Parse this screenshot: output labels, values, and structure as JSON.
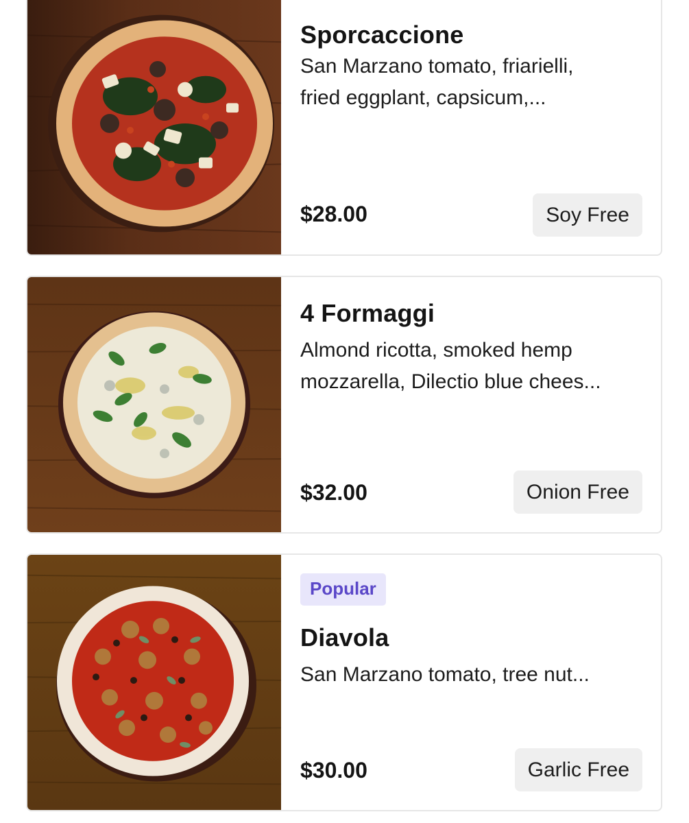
{
  "items": [
    {
      "name": "Sporcaccione",
      "description": "San Marzano tomato, friarielli,\nfried eggplant, capsicum,...",
      "price": "$28.00",
      "dietary_tag": "Soy Free",
      "badge": ""
    },
    {
      "name": "4 Formaggi",
      "description": "Almond ricotta, smoked hemp\nmozzarella, Dilectio blue chees...",
      "price": "$32.00",
      "dietary_tag": "Onion Free",
      "badge": ""
    },
    {
      "name": "Diavola",
      "description": "San Marzano tomato, tree nut...",
      "price": "$30.00",
      "dietary_tag": "Garlic Free",
      "badge": "Popular"
    }
  ],
  "colors": {
    "badge_bg": "#e8e6fb",
    "badge_text": "#5a47c8",
    "tag_bg": "#efefef",
    "card_border": "#e6e6e6"
  }
}
